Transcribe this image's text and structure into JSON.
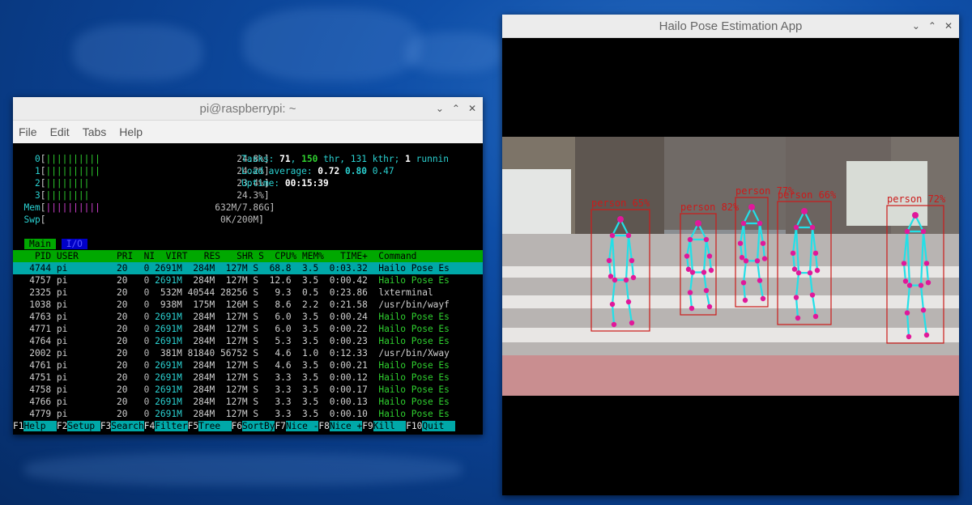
{
  "terminal": {
    "title": "pi@raspberrypi: ~",
    "menu": [
      "File",
      "Edit",
      "Tabs",
      "Help"
    ],
    "cpu_bars": [
      {
        "label": "0",
        "bars": "||||||||||",
        "pct": "24.8%"
      },
      {
        "label": "1",
        "bars": "||||||||||",
        "pct": "24.2%"
      },
      {
        "label": "2",
        "bars": "||||||||",
        "pct": "23.4%"
      },
      {
        "label": "3",
        "bars": "||||||||",
        "pct": "24.3%"
      }
    ],
    "mem": {
      "label": "Mem",
      "bars": "||||||||||",
      "value": "632M/7.86G"
    },
    "swp": {
      "label": "Swp",
      "value": "0K/200M"
    },
    "tasks_label": "Tasks: ",
    "tasks": "71",
    "thr": "150",
    "thr_label": " thr, ",
    "kthr": "131 kthr; ",
    "running": "1",
    "running_label": " runnin",
    "load_label": "Load average: ",
    "load1": "0.72",
    "load5": "0.80",
    "load15": "0.47",
    "uptime_label": "Uptime: ",
    "uptime": "00:15:39",
    "tab_main": "Main",
    "tab_io": "I/O",
    "header": "    PID USER       PRI  NI  VIRT   RES   SHR S  CPU% MEM%   TIME+  Command",
    "rows": [
      {
        "pid": "4744",
        "user": "pi",
        "pri": "20",
        "ni": "0",
        "virt": "2691M",
        "res": "284M",
        "shr": "127M",
        "s": "S",
        "cpu": "68.8",
        "mem": "3.5",
        "time": "0:03.32",
        "cmd": "Hailo Pose Es"
      },
      {
        "pid": "4757",
        "user": "pi",
        "pri": "20",
        "ni": "0",
        "virt": "2691M",
        "res": "284M",
        "shr": "127M",
        "s": "S",
        "cpu": "12.6",
        "mem": "3.5",
        "time": "0:00.42",
        "cmd": "Hailo Pose Es"
      },
      {
        "pid": "2325",
        "user": "pi",
        "pri": "20",
        "ni": "0",
        "virt": "532M",
        "res": "40544",
        "shr": "28256",
        "s": "S",
        "cpu": "9.3",
        "mem": "0.5",
        "time": "0:23.86",
        "cmd": "lxterminal"
      },
      {
        "pid": "1038",
        "user": "pi",
        "pri": "20",
        "ni": "0",
        "virt": "938M",
        "res": "175M",
        "shr": "126M",
        "s": "S",
        "cpu": "8.6",
        "mem": "2.2",
        "time": "0:21.58",
        "cmd": "/usr/bin/wayf"
      },
      {
        "pid": "4763",
        "user": "pi",
        "pri": "20",
        "ni": "0",
        "virt": "2691M",
        "res": "284M",
        "shr": "127M",
        "s": "S",
        "cpu": "6.0",
        "mem": "3.5",
        "time": "0:00.24",
        "cmd": "Hailo Pose Es"
      },
      {
        "pid": "4771",
        "user": "pi",
        "pri": "20",
        "ni": "0",
        "virt": "2691M",
        "res": "284M",
        "shr": "127M",
        "s": "S",
        "cpu": "6.0",
        "mem": "3.5",
        "time": "0:00.22",
        "cmd": "Hailo Pose Es"
      },
      {
        "pid": "4764",
        "user": "pi",
        "pri": "20",
        "ni": "0",
        "virt": "2691M",
        "res": "284M",
        "shr": "127M",
        "s": "S",
        "cpu": "5.3",
        "mem": "3.5",
        "time": "0:00.23",
        "cmd": "Hailo Pose Es"
      },
      {
        "pid": "2002",
        "user": "pi",
        "pri": "20",
        "ni": "0",
        "virt": "381M",
        "res": "81840",
        "shr": "56752",
        "s": "S",
        "cpu": "4.6",
        "mem": "1.0",
        "time": "0:12.33",
        "cmd": "/usr/bin/Xway"
      },
      {
        "pid": "4761",
        "user": "pi",
        "pri": "20",
        "ni": "0",
        "virt": "2691M",
        "res": "284M",
        "shr": "127M",
        "s": "S",
        "cpu": "4.6",
        "mem": "3.5",
        "time": "0:00.21",
        "cmd": "Hailo Pose Es"
      },
      {
        "pid": "4751",
        "user": "pi",
        "pri": "20",
        "ni": "0",
        "virt": "2691M",
        "res": "284M",
        "shr": "127M",
        "s": "S",
        "cpu": "3.3",
        "mem": "3.5",
        "time": "0:00.12",
        "cmd": "Hailo Pose Es"
      },
      {
        "pid": "4758",
        "user": "pi",
        "pri": "20",
        "ni": "0",
        "virt": "2691M",
        "res": "284M",
        "shr": "127M",
        "s": "S",
        "cpu": "3.3",
        "mem": "3.5",
        "time": "0:00.17",
        "cmd": "Hailo Pose Es"
      },
      {
        "pid": "4766",
        "user": "pi",
        "pri": "20",
        "ni": "0",
        "virt": "2691M",
        "res": "284M",
        "shr": "127M",
        "s": "S",
        "cpu": "3.3",
        "mem": "3.5",
        "time": "0:00.13",
        "cmd": "Hailo Pose Es"
      },
      {
        "pid": "4779",
        "user": "pi",
        "pri": "20",
        "ni": "0",
        "virt": "2691M",
        "res": "284M",
        "shr": "127M",
        "s": "S",
        "cpu": "3.3",
        "mem": "3.5",
        "time": "0:00.10",
        "cmd": "Hailo Pose Es"
      }
    ],
    "fkeys": [
      {
        "k": "F1",
        "l": "Help  "
      },
      {
        "k": "F2",
        "l": "Setup "
      },
      {
        "k": "F3",
        "l": "Search"
      },
      {
        "k": "F4",
        "l": "Filter"
      },
      {
        "k": "F5",
        "l": "Tree  "
      },
      {
        "k": "F6",
        "l": "SortBy"
      },
      {
        "k": "F7",
        "l": "Nice -"
      },
      {
        "k": "F8",
        "l": "Nice +"
      },
      {
        "k": "F9",
        "l": "Kill  "
      },
      {
        "k": "F10",
        "l": "Quit  "
      }
    ]
  },
  "pose_app": {
    "title": "Hailo Pose Estimation App",
    "detections": [
      {
        "label": "person 65%"
      },
      {
        "label": "person 82%"
      },
      {
        "label": "person 77%"
      },
      {
        "label": "person 66%"
      },
      {
        "label": "person 72%"
      }
    ],
    "box_color": "#cc1a1a",
    "skeleton_color": "#22e0e8",
    "joint_color": "#e0189a"
  },
  "window_controls": {
    "menu": "chevron-down-icon",
    "maximize": "chevron-up-icon",
    "close": "close-icon"
  },
  "desktop": {
    "background": "#0a3f8e"
  }
}
